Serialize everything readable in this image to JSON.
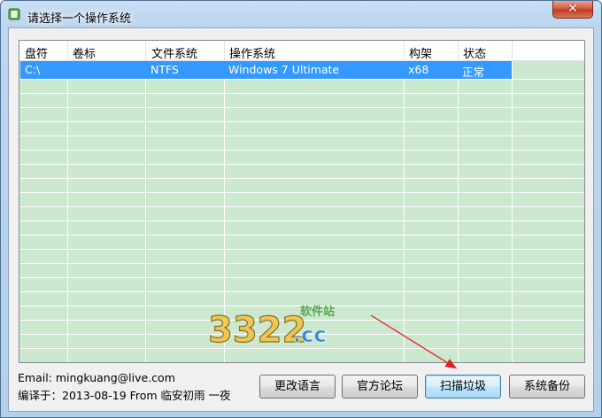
{
  "window": {
    "title": "请选择一个操作系统",
    "close_symbol": "✕"
  },
  "table": {
    "columns": [
      "盘符",
      "卷标",
      "文件系统",
      "操作系统",
      "构架",
      "状态"
    ],
    "rows": [
      {
        "drive": "C:\\",
        "label": "",
        "fs": "NTFS",
        "os": "Windows 7 Ultimate",
        "arch": "x68",
        "status": "正常",
        "selected": true
      }
    ]
  },
  "footer": {
    "email": "Email: mingkuang@live.com",
    "compiled": "编译于：2013-08-19 From 临安初雨 一夜"
  },
  "buttons": {
    "change_language": "更改语言",
    "forum": "官方论坛",
    "clean_junk": "扫描垃圾",
    "backup": "系统备份"
  },
  "watermark": {
    "number": "3322",
    "domain": ".cc",
    "site": "软件站"
  },
  "colors": {
    "grid_bg": "#cce8cf",
    "selection": "#3399ff",
    "titlebar": "#bcd6ee",
    "close": "#c43b22",
    "annotation_arrow": "#e02020"
  },
  "icons": [
    "app-icon",
    "close-icon",
    "red-arrow-annotation"
  ]
}
